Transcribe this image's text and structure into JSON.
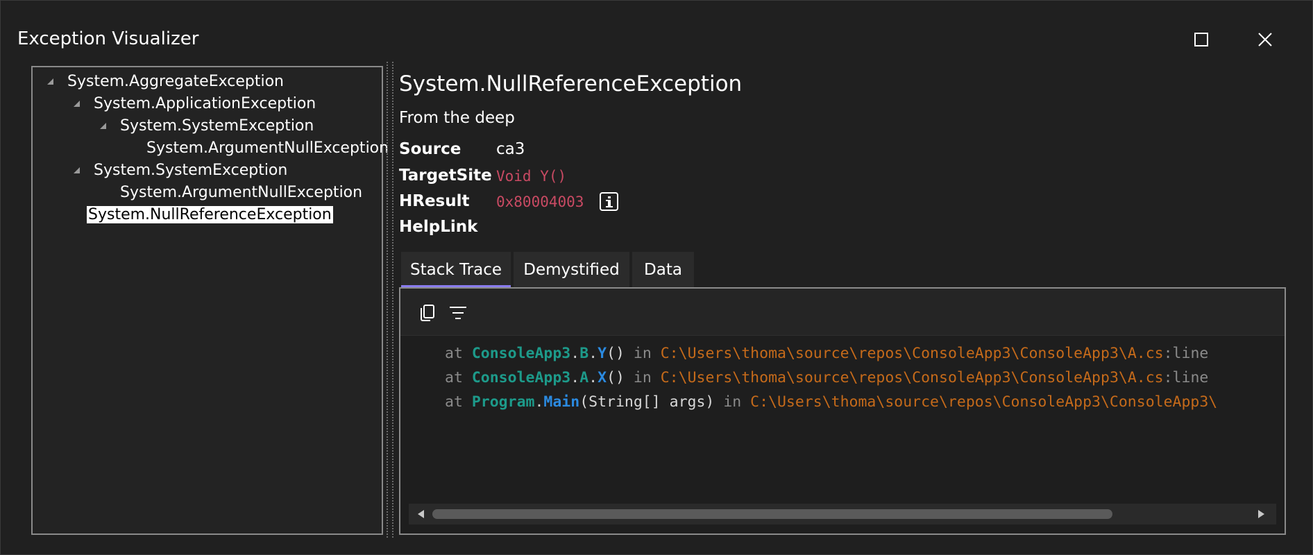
{
  "window": {
    "title": "Exception Visualizer",
    "maximize_icon": "maximize-icon",
    "close_icon": "close-icon"
  },
  "tree": {
    "items": [
      {
        "label": "System.AggregateException",
        "level": 0,
        "expanded": true
      },
      {
        "label": "System.ApplicationException",
        "level": 1,
        "expanded": true
      },
      {
        "label": "System.SystemException",
        "level": 2,
        "expanded": true
      },
      {
        "label": "System.ArgumentNullException",
        "level": 3,
        "expanded": null
      },
      {
        "label": "System.SystemException",
        "level": 1,
        "expanded": true
      },
      {
        "label": "System.ArgumentNullException",
        "level": 2,
        "expanded": null
      },
      {
        "label": "System.NullReferenceException",
        "level": 1,
        "expanded": null,
        "selected": true
      }
    ]
  },
  "detail": {
    "exception_type": "System.NullReferenceException",
    "message": "From the deep",
    "properties": {
      "source_label": "Source",
      "source_value": "ca3",
      "targetsite_label": "TargetSite",
      "targetsite_value": "Void Y()",
      "hresult_label": "HResult",
      "hresult_value": "0x80004003",
      "helplink_label": "HelpLink",
      "helplink_value": ""
    },
    "hresult_info_icon": "info-icon"
  },
  "tabs": [
    {
      "label": "Stack Trace",
      "active": true
    },
    {
      "label": "Demystified",
      "active": false
    },
    {
      "label": "Data",
      "active": false
    }
  ],
  "stack_toolbar": {
    "copy_icon": "copy-icon",
    "filter_icon": "filter-icon"
  },
  "stack_trace": {
    "lines": [
      {
        "at": "at",
        "ns": "ConsoleApp3",
        "dot1": ".",
        "cls": "B",
        "dot2": ".",
        "method": "Y",
        "params": "()",
        "in": "in",
        "path": "C:\\Users\\thoma\\source\\repos\\ConsoleApp3\\ConsoleApp3\\A.cs",
        "line": ":line"
      },
      {
        "at": "at",
        "ns": "ConsoleApp3",
        "dot1": ".",
        "cls": "A",
        "dot2": ".",
        "method": "X",
        "params": "()",
        "in": "in",
        "path": "C:\\Users\\thoma\\source\\repos\\ConsoleApp3\\ConsoleApp3\\A.cs",
        "line": ":line"
      },
      {
        "at": "at",
        "ns": "Program",
        "dot1": "",
        "cls": "",
        "dot2": ".",
        "method": "Main",
        "params": "(String[] args)",
        "in": "in",
        "path": "C:\\Users\\thoma\\source\\repos\\ConsoleApp3\\ConsoleApp3\\",
        "line": ""
      }
    ]
  },
  "colors": {
    "accent_tab_underline": "#8a7cf0",
    "code_value": "#c94a63",
    "path": "#c56a1a",
    "namespace": "#1d9a8a",
    "method": "#2b8ae0"
  }
}
